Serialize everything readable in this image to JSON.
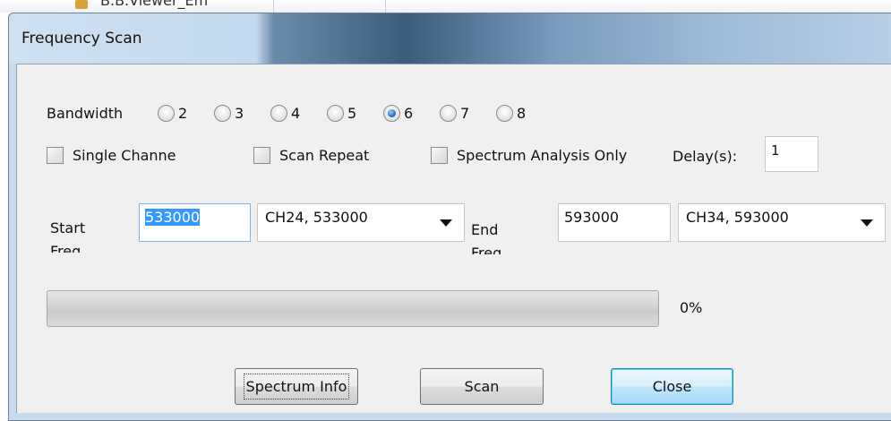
{
  "background_window": {
    "title_fragment": "B.B.Viewer_Em"
  },
  "window": {
    "title": "Frequency Scan"
  },
  "bandwidth": {
    "label": "Bandwidth",
    "options": [
      "2",
      "3",
      "4",
      "5",
      "6",
      "7",
      "8"
    ],
    "selected": "6"
  },
  "options": {
    "single_channel": {
      "label": "Single Channe",
      "checked": false
    },
    "scan_repeat": {
      "label": "Scan Repeat",
      "checked": false
    },
    "spectrum_only": {
      "label": "Spectrum Analysis Only",
      "checked": false
    },
    "delay": {
      "label": "Delay(s):",
      "value": "1"
    }
  },
  "start": {
    "label": "Start Freq",
    "value": "533000",
    "channel": "CH24, 533000"
  },
  "end": {
    "label": "End Freq",
    "value": "593000",
    "channel": "CH34, 593000"
  },
  "progress": {
    "percent": 0,
    "label": "0%"
  },
  "buttons": {
    "spectrum_info": "Spectrum Info",
    "scan": "Scan",
    "close": "Close"
  },
  "icons": {
    "radio_selected": "radio-selected-icon",
    "radio_unselected": "radio-unselected-icon",
    "checkbox": "checkbox-icon",
    "dropdown": "chevron-down-icon"
  },
  "colors": {
    "titlebar": "#c7dbee",
    "client": "#f0f0f0",
    "selection": "#3399ff"
  }
}
